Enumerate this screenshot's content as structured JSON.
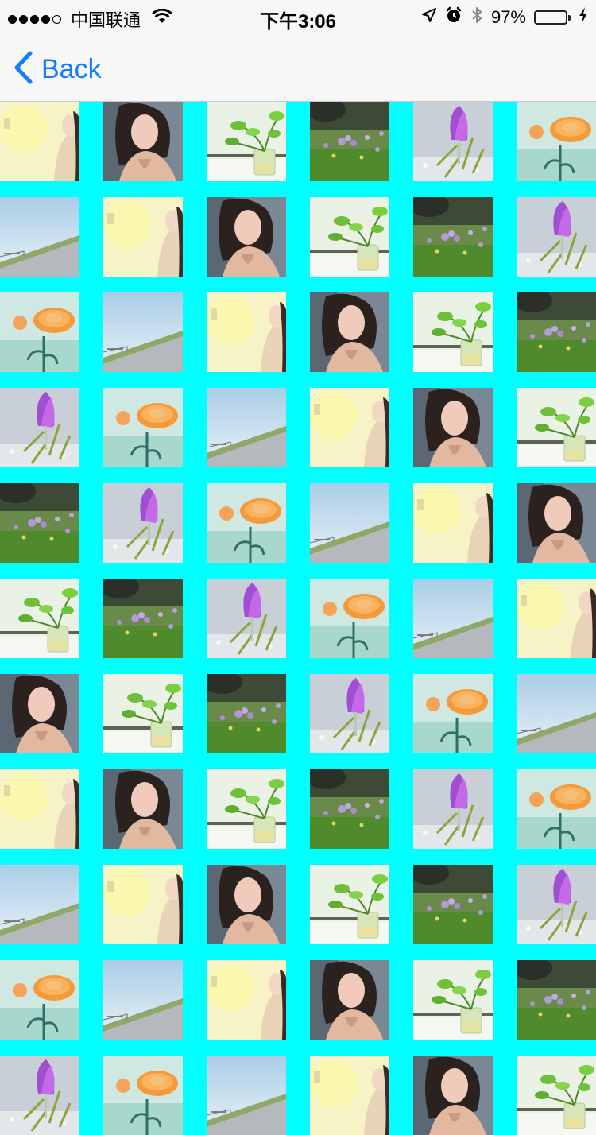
{
  "status_bar": {
    "carrier": "中国联通",
    "time": "下午3:06",
    "battery_percent": "97%",
    "battery_level": 0.97,
    "signal_bars_filled": 4,
    "signal_bars_total": 5,
    "icons": [
      "wifi-icon",
      "location-arrow-icon",
      "alarm-icon",
      "bluetooth-icon",
      "battery-icon",
      "charging-bolt-icon"
    ]
  },
  "nav": {
    "back_label": "Back",
    "back_icon": "chevron-left-icon",
    "accent_color": "#157efb"
  },
  "grid": {
    "background_color": "#00FFFF",
    "columns": 6,
    "rows": [
      [
        "girl-light",
        "girl-dark",
        "plant-glass",
        "purple-wildflowers",
        "purple-crocus",
        "orange-flower"
      ],
      [
        "road-sky",
        "girl-light",
        "girl-dark",
        "plant-glass",
        "purple-wildflowers",
        "purple-crocus"
      ],
      [
        "orange-flower",
        "road-sky",
        "girl-light",
        "girl-dark",
        "plant-glass",
        "purple-wildflowers"
      ],
      [
        "purple-crocus",
        "orange-flower",
        "road-sky",
        "girl-light",
        "girl-dark",
        "plant-glass"
      ],
      [
        "purple-wildflowers",
        "purple-crocus",
        "orange-flower",
        "road-sky",
        "girl-light",
        "girl-dark"
      ],
      [
        "plant-glass",
        "purple-wildflowers",
        "purple-crocus",
        "orange-flower",
        "road-sky",
        "girl-light"
      ],
      [
        "girl-dark",
        "plant-glass",
        "purple-wildflowers",
        "purple-crocus",
        "orange-flower",
        "road-sky"
      ],
      [
        "girl-light",
        "girl-dark",
        "plant-glass",
        "purple-wildflowers",
        "purple-crocus",
        "orange-flower"
      ],
      [
        "road-sky",
        "girl-light",
        "girl-dark",
        "plant-glass",
        "purple-wildflowers",
        "purple-crocus"
      ],
      [
        "orange-flower",
        "road-sky",
        "girl-light",
        "girl-dark",
        "plant-glass",
        "purple-wildflowers"
      ],
      [
        "purple-crocus",
        "orange-flower",
        "road-sky",
        "girl-light",
        "girl-dark",
        "plant-glass"
      ]
    ]
  }
}
